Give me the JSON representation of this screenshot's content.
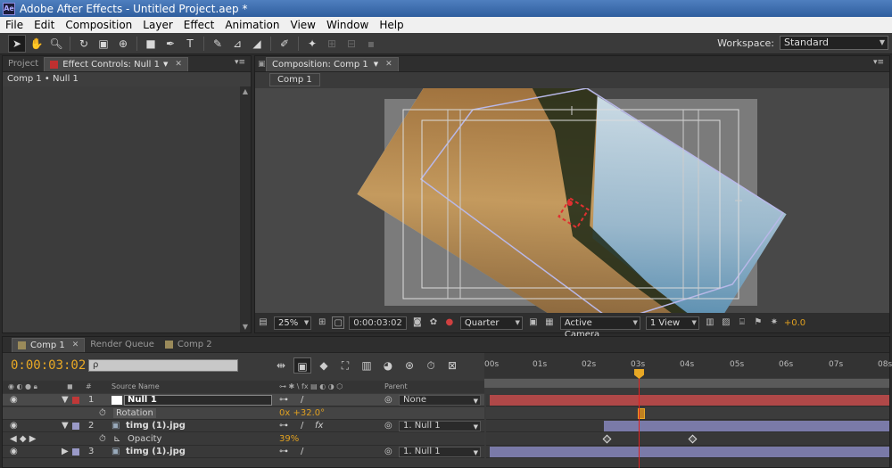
{
  "window": {
    "title": "Adobe After Effects - Untitled Project.aep *",
    "app_icon": "Ae"
  },
  "menu": [
    "File",
    "Edit",
    "Composition",
    "Layer",
    "Effect",
    "Animation",
    "View",
    "Window",
    "Help"
  ],
  "toolbar": {
    "tools": [
      "selection-tool-icon",
      "hand-tool-icon",
      "zoom-tool-icon",
      "rotate-tool-icon",
      "camera-tool-icon",
      "pan-behind-tool-icon",
      "rectangle-tool-icon",
      "pen-tool-icon",
      "type-tool-icon",
      "brush-tool-icon",
      "eraser-tool-icon",
      "roto-brush-icon",
      "puppet-pin-icon"
    ],
    "workspace_label": "Workspace:",
    "workspace_value": "Standard"
  },
  "left_panel": {
    "tabs": [
      {
        "label": "Project"
      },
      {
        "label": "Effect Controls: Null 1"
      }
    ],
    "breadcrumb": "Comp 1 • Null 1"
  },
  "comp_panel": {
    "tab_label": "Composition: Comp 1",
    "subtab": "Comp 1",
    "footer": {
      "zoom": "25%",
      "timecode": "0:00:03:02",
      "resolution": "Quarter",
      "camera": "Active Camera",
      "view": "1 View",
      "exposure": "+0.0"
    }
  },
  "timeline": {
    "tabs": [
      {
        "label": "Comp 1"
      },
      {
        "label": "Render Queue"
      },
      {
        "label": "Comp 2"
      }
    ],
    "timecode": "0:00:03:02",
    "search_placeholder": "ρ",
    "ruler": [
      "00s",
      "01s",
      "02s",
      "03s",
      "04s",
      "05s",
      "06s",
      "07s",
      "08s"
    ],
    "columns": {
      "num": "#",
      "source": "Source Name",
      "parent": "Parent"
    },
    "layers": [
      {
        "num": "1",
        "name": "Null 1",
        "parent": "None",
        "color": "#b03030",
        "selected": true
      },
      {
        "prop": "Rotation",
        "value": "0x +32.0°"
      },
      {
        "num": "2",
        "name": "timg (1).jpg",
        "parent": "1. Null 1",
        "color": "#8a8ab8"
      },
      {
        "prop": "Opacity",
        "value": "39%"
      },
      {
        "num": "3",
        "name": "timg (1).jpg",
        "parent": "1. Null 1",
        "color": "#8a8ab8"
      }
    ]
  },
  "colors": {
    "accent": "#e8a825",
    "layer_red": "#b03030",
    "layer_purple": "#7a7aa8"
  }
}
